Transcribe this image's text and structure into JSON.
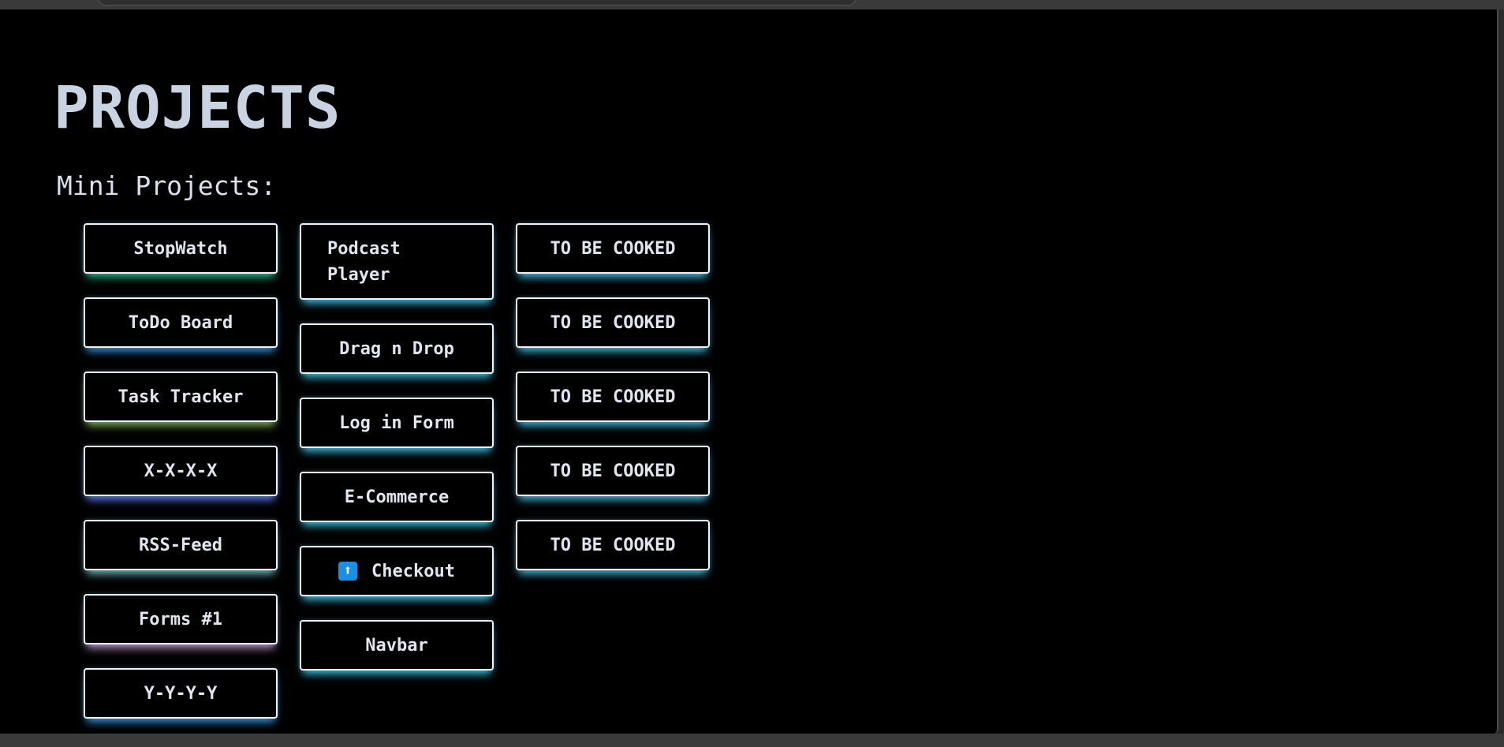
{
  "page": {
    "title": "PROJECTS",
    "section_title": "Mini Projects:"
  },
  "columns": [
    {
      "items": [
        {
          "label": "StopWatch",
          "glow": "#28c88c"
        },
        {
          "label": "ToDo Board",
          "glow": "#3c96e6"
        },
        {
          "label": "Task Tracker",
          "glow": "#8cbe5a"
        },
        {
          "label": "X-X-X-X",
          "glow": "#5a78f0"
        },
        {
          "label": "RSS-Feed",
          "glow": "#78c8c8"
        },
        {
          "label": "Forms #1",
          "glow": "#c8a0dc"
        },
        {
          "label": "Y-Y-Y-Y",
          "glow": "#3c96e6"
        }
      ]
    },
    {
      "items": [
        {
          "label": "Podcast Player",
          "glow": "#46c8eb"
        },
        {
          "label": "Drag n Drop",
          "glow": "#46c8eb"
        },
        {
          "label": "Log in Form",
          "glow": "#46c8eb"
        },
        {
          "label": "E-Commerce",
          "glow": "#46c8eb"
        },
        {
          "label": "Checkout",
          "icon": "up-arrow-icon",
          "icon_glyph": "⬆",
          "glow": "#46c8eb"
        },
        {
          "label": "Navbar",
          "glow": "#46c8eb"
        }
      ]
    },
    {
      "items": [
        {
          "label": "TO BE COOKED",
          "glow": "#46c8eb"
        },
        {
          "label": "TO BE COOKED",
          "glow": "#46c8eb"
        },
        {
          "label": "TO BE COOKED",
          "glow": "#46c8eb"
        },
        {
          "label": "TO BE COOKED",
          "glow": "#46c8eb"
        },
        {
          "label": "TO BE COOKED",
          "glow": "#46c8eb"
        }
      ]
    }
  ],
  "colors": {
    "background": "#000000",
    "title": "#c9d4e3",
    "card_border": "#eef3f8"
  }
}
